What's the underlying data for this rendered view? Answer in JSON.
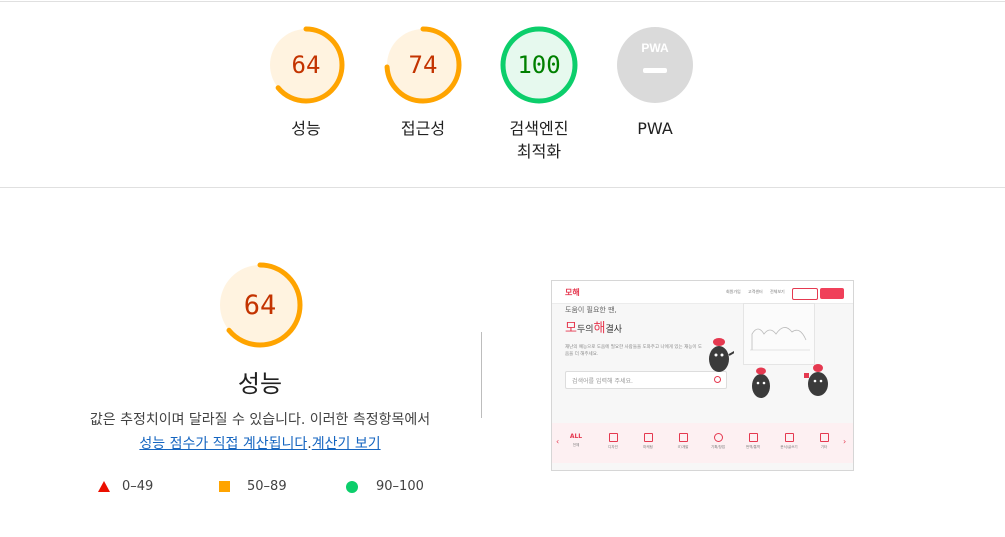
{
  "categories": [
    {
      "score": "64",
      "label": "성능",
      "score_fraction": 0.64,
      "color": "#ffa400",
      "bg": "#fff3e0"
    },
    {
      "score": "74",
      "label": "접근성",
      "score_fraction": 0.74,
      "color": "#ffa400",
      "bg": "#fff3e0"
    },
    {
      "score": "100",
      "label_line1": "검색엔진",
      "label_line2": "최적화",
      "score_fraction": 1.0,
      "color": "#0cce6b",
      "bg": "#e6f9ee"
    },
    {
      "badge": "PWA",
      "label": "PWA",
      "color": "#dadada"
    }
  ],
  "performance": {
    "score": "64",
    "score_fraction": 0.64,
    "title": "성능",
    "desc_line1": "값은 추정치이며 달라질 수 있습니다. 이러한 측정항목에서",
    "desc_link1": "성능 점수가 직접 계산됩니다",
    "desc_period": ".",
    "desc_link2": "계산기 보기",
    "link_color": "#1565c0"
  },
  "legend": [
    {
      "shape": "triangle",
      "range": "0–49",
      "color": "#eb0f00"
    },
    {
      "shape": "square",
      "range": "50–89",
      "color": "#ffa400"
    },
    {
      "shape": "circle",
      "range": "90–100",
      "color": "#0cce6b"
    }
  ],
  "screenshot": {
    "logo": "모해",
    "nav": [
      "회원가입",
      "고객센터",
      "전체보기"
    ],
    "sub": "도움이 필요한 땐,",
    "title_accent1": "모",
    "title_part1": "두의",
    "title_accent2": "해",
    "title_part2": "결사",
    "small_text": "재난의 예능으로 도움에 필요한 사람들을 도와주고 나에게 있는 재능이 도움을 더 해주세요.",
    "search_placeholder": "검색어를 입력해 주세요.",
    "categories": [
      {
        "icon": "ALL",
        "label": "전체"
      },
      {
        "icon": "design-icon",
        "label": "디자인"
      },
      {
        "icon": "marketing-icon",
        "label": "마케팅"
      },
      {
        "icon": "it-icon",
        "label": "IT/개발"
      },
      {
        "icon": "idea-icon",
        "label": "기획/창업"
      },
      {
        "icon": "translate-icon",
        "label": "번역/통역"
      },
      {
        "icon": "document-icon",
        "label": "문서/글쓰기"
      },
      {
        "icon": "etc-icon",
        "label": "기타"
      }
    ]
  }
}
